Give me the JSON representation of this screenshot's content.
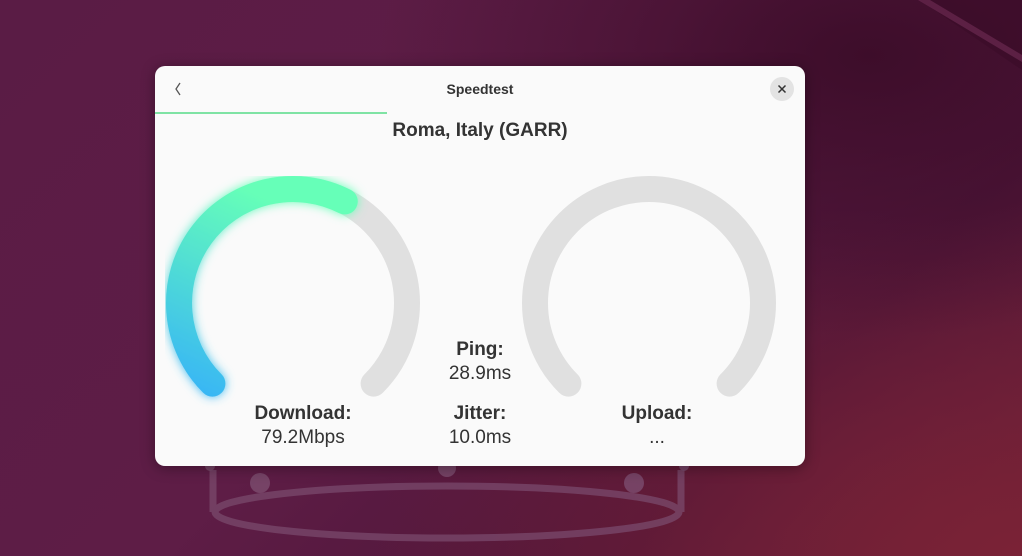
{
  "window": {
    "title": "Speedtest"
  },
  "progress": {
    "fraction": 0.357,
    "color": "#7fe3a4"
  },
  "server": {
    "name": "Roma, Italy (GARR)"
  },
  "download": {
    "label": "Download:",
    "value": "79.2Mbps",
    "gauge_fraction": 0.6,
    "gradient_start": "#38b6f5",
    "gradient_end": "#66ffb8"
  },
  "ping": {
    "label": "Ping:",
    "value": "28.9ms"
  },
  "jitter": {
    "label": "Jitter:",
    "value": "10.0ms"
  },
  "upload": {
    "label": "Upload:",
    "value": "...",
    "gauge_fraction": 0
  },
  "colors": {
    "track": "#e0e0e0",
    "text": "#333333"
  },
  "icons": {
    "back": "chevron-left-icon",
    "close": "close-icon"
  }
}
